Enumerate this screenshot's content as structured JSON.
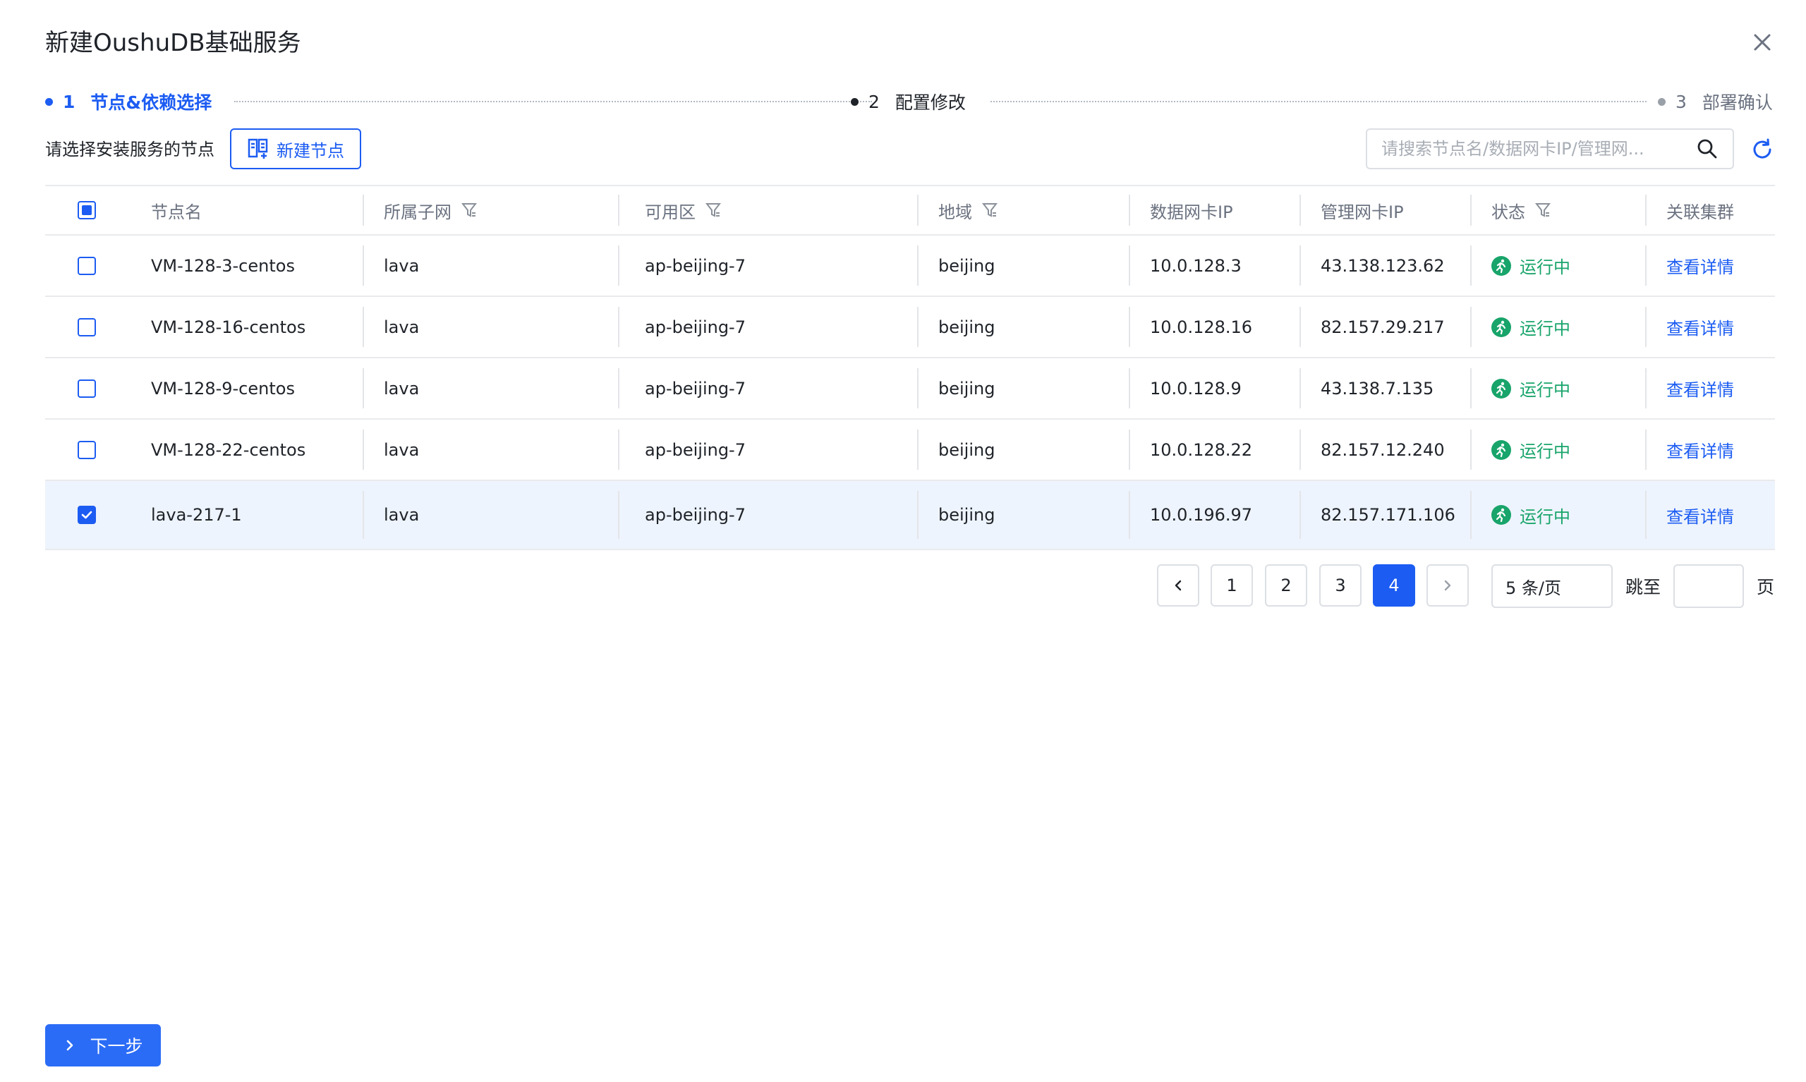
{
  "dialog": {
    "title": "新建OushuDB基础服务"
  },
  "stepper": {
    "steps": [
      {
        "num": "1",
        "label": "节点&依赖选择"
      },
      {
        "num": "2",
        "label": "配置修改"
      },
      {
        "num": "3",
        "label": "部署确认"
      }
    ]
  },
  "toolbar": {
    "select_label": "请选择安装服务的节点",
    "new_node_label": "新建节点",
    "search_placeholder": "请搜索节点名/数据网卡IP/管理网..."
  },
  "table": {
    "columns": [
      "节点名",
      "所属子网",
      "可用区",
      "地域",
      "数据网卡IP",
      "管理网卡IP",
      "状态",
      "关联集群"
    ],
    "rows": [
      {
        "name": "VM-128-3-centos",
        "subnet": "lava",
        "zone": "ap-beijing-7",
        "region": "beijing",
        "data_ip": "10.0.128.3",
        "mgmt_ip": "43.138.123.62",
        "status": "运行中",
        "action": "查看详情",
        "checked": false
      },
      {
        "name": "VM-128-16-centos",
        "subnet": "lava",
        "zone": "ap-beijing-7",
        "region": "beijing",
        "data_ip": "10.0.128.16",
        "mgmt_ip": "82.157.29.217",
        "status": "运行中",
        "action": "查看详情",
        "checked": false
      },
      {
        "name": "VM-128-9-centos",
        "subnet": "lava",
        "zone": "ap-beijing-7",
        "region": "beijing",
        "data_ip": "10.0.128.9",
        "mgmt_ip": "43.138.7.135",
        "status": "运行中",
        "action": "查看详情",
        "checked": false
      },
      {
        "name": "VM-128-22-centos",
        "subnet": "lava",
        "zone": "ap-beijing-7",
        "region": "beijing",
        "data_ip": "10.0.128.22",
        "mgmt_ip": "82.157.12.240",
        "status": "运行中",
        "action": "查看详情",
        "checked": false
      },
      {
        "name": "lava-217-1",
        "subnet": "lava",
        "zone": "ap-beijing-7",
        "region": "beijing",
        "data_ip": "10.0.196.97",
        "mgmt_ip": "82.157.171.106",
        "status": "运行中",
        "action": "查看详情",
        "checked": true
      }
    ]
  },
  "pagination": {
    "pages": [
      "1",
      "2",
      "3",
      "4"
    ],
    "current": "4",
    "page_size": "5 条/页",
    "jump_label": "跳至",
    "page_label": "页"
  },
  "footer": {
    "next_label": "下一步"
  },
  "colors": {
    "primary": "#1c5cf2",
    "success": "#18a46a",
    "selected_row": "#eef4fd"
  }
}
